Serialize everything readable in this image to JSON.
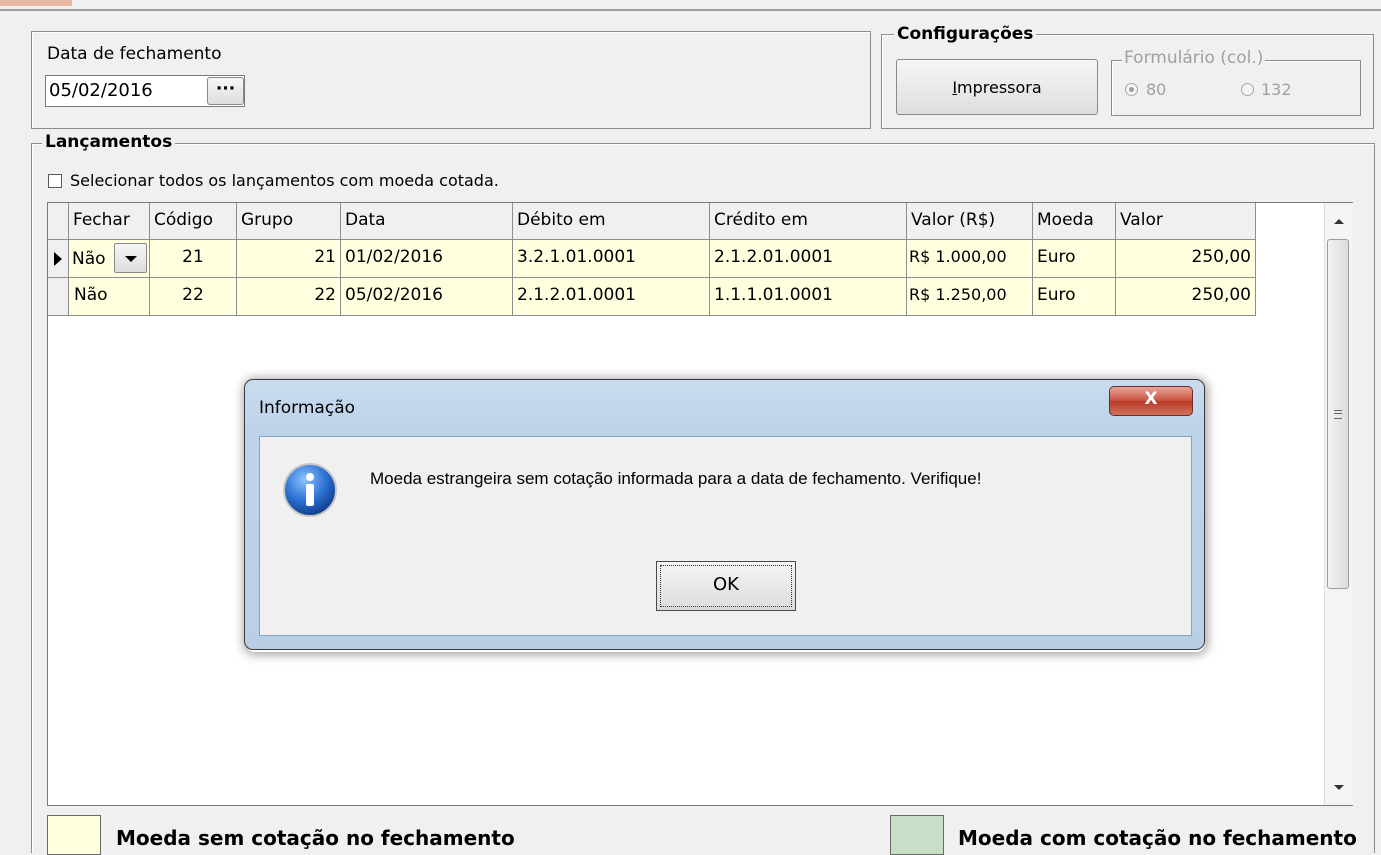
{
  "fechamento": {
    "label": "Data de fechamento",
    "date_value": "05/02/2016",
    "picker_label": "···"
  },
  "config": {
    "title": "Configurações",
    "printer_button": "Impressora",
    "printer_mnemonic": "I",
    "printer_rest": "mpressora",
    "form_title": "Formulário (col.)",
    "options": [
      {
        "label": "80",
        "selected": true
      },
      {
        "label": "132",
        "selected": false
      }
    ]
  },
  "lancamentos": {
    "title": "Lançamentos",
    "select_all_label": "Selecionar todos os lançamentos com moeda cotada.",
    "columns": [
      "Fechar",
      "Código",
      "Grupo",
      "Data",
      "Débito em",
      "Crédito em",
      "Valor (R$)",
      "Moeda",
      "Valor"
    ],
    "rows": [
      {
        "fechar": "Não",
        "codigo": "21",
        "grupo": "21",
        "data": "01/02/2016",
        "debito": "3.2.1.01.0001",
        "credito": "2.1.2.01.0001",
        "valor_brl": "R$ 1.000,00",
        "moeda": "Euro",
        "valor": "250,00"
      },
      {
        "fechar": "Não",
        "codigo": "22",
        "grupo": "22",
        "data": "05/02/2016",
        "debito": "2.1.2.01.0001",
        "credito": "1.1.1.01.0001",
        "valor_brl": "R$ 1.250,00",
        "moeda": "Euro",
        "valor": "250,00"
      }
    ]
  },
  "dialog": {
    "title": "Informação",
    "message": "Moeda estrangeira sem cotação informada para a data de fechamento. Verifique!",
    "ok_label": "OK",
    "close_label": "X",
    "icon": "information-icon"
  },
  "legend": {
    "sem_cotacao": "Moeda sem cotação no fechamento",
    "com_cotacao": "Moeda com cotação no fechamento",
    "sem_color": "#ffffe0",
    "com_color": "#c6dfc6"
  }
}
